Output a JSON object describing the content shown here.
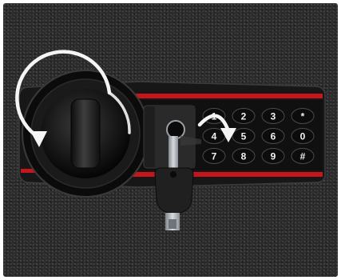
{
  "scene": {
    "subject": "electronic-safe-lock-panel",
    "colors": {
      "carpet": "#2a2a2a",
      "panel": "#151515",
      "red_stripe": "#c4161c",
      "key_face": "#0c0c0c",
      "arrow": "#f5f5f5",
      "key_metal": "#b8bcc2"
    }
  },
  "keypad": {
    "rows": [
      [
        "1",
        "2",
        "3",
        "*"
      ],
      [
        "4",
        "5",
        "6",
        "0"
      ],
      [
        "7",
        "8",
        "9",
        "#"
      ]
    ]
  },
  "icons": [
    "rotate-counterclockwise-arrow-icon",
    "curved-turn-arrow-icon"
  ]
}
